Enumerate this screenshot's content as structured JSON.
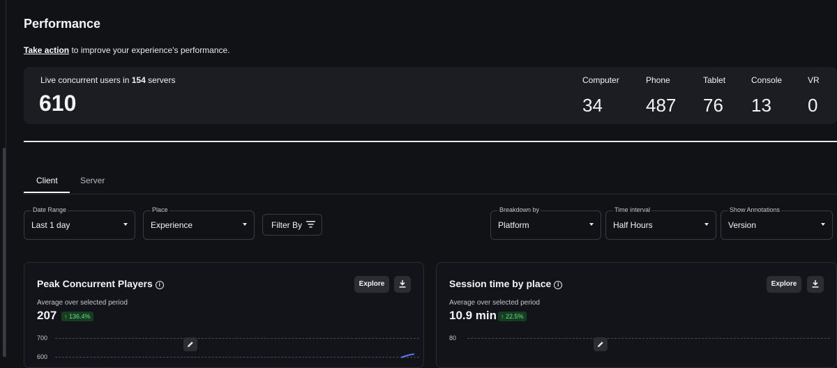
{
  "page": {
    "title": "Performance",
    "subtitle_link": "Take action",
    "subtitle_rest": " to improve your experience's performance."
  },
  "live": {
    "label_prefix": "Live concurrent users in ",
    "servers": "154",
    "label_suffix": " servers",
    "total": "610",
    "platforms": [
      {
        "name": "Computer",
        "value": "34"
      },
      {
        "name": "Phone",
        "value": "487"
      },
      {
        "name": "Tablet",
        "value": "76"
      },
      {
        "name": "Console",
        "value": "13"
      },
      {
        "name": "VR",
        "value": "0"
      }
    ]
  },
  "tabs": [
    {
      "label": "Client",
      "active": true
    },
    {
      "label": "Server",
      "active": false
    }
  ],
  "filters": {
    "date_range": {
      "label": "Date Range",
      "value": "Last 1 day"
    },
    "place": {
      "label": "Place",
      "value": "Experience"
    },
    "filter_by": "Filter By",
    "breakdown": {
      "label": "Breakdown by",
      "value": "Platform"
    },
    "interval": {
      "label": "Time interval",
      "value": "Half Hours"
    },
    "annotations": {
      "label": "Show Annotations",
      "value": "Version"
    }
  },
  "cards": {
    "peak": {
      "title": "Peak Concurrent Players",
      "explore": "Explore",
      "avg_label": "Average over selected period",
      "value": "207",
      "change": "↑ 136.4%",
      "ticks": [
        "700",
        "600"
      ]
    },
    "session": {
      "title": "Session time by place",
      "explore": "Explore",
      "avg_label": "Average over selected period",
      "value": "10.9 min",
      "change": "↑ 22.5%",
      "ticks": [
        "80"
      ]
    }
  },
  "colors": {
    "background": "#111216",
    "card": "#1c1d22",
    "badge_bg": "#143d22",
    "badge_text": "#6fdc8c",
    "line": "#5b7cf5"
  }
}
